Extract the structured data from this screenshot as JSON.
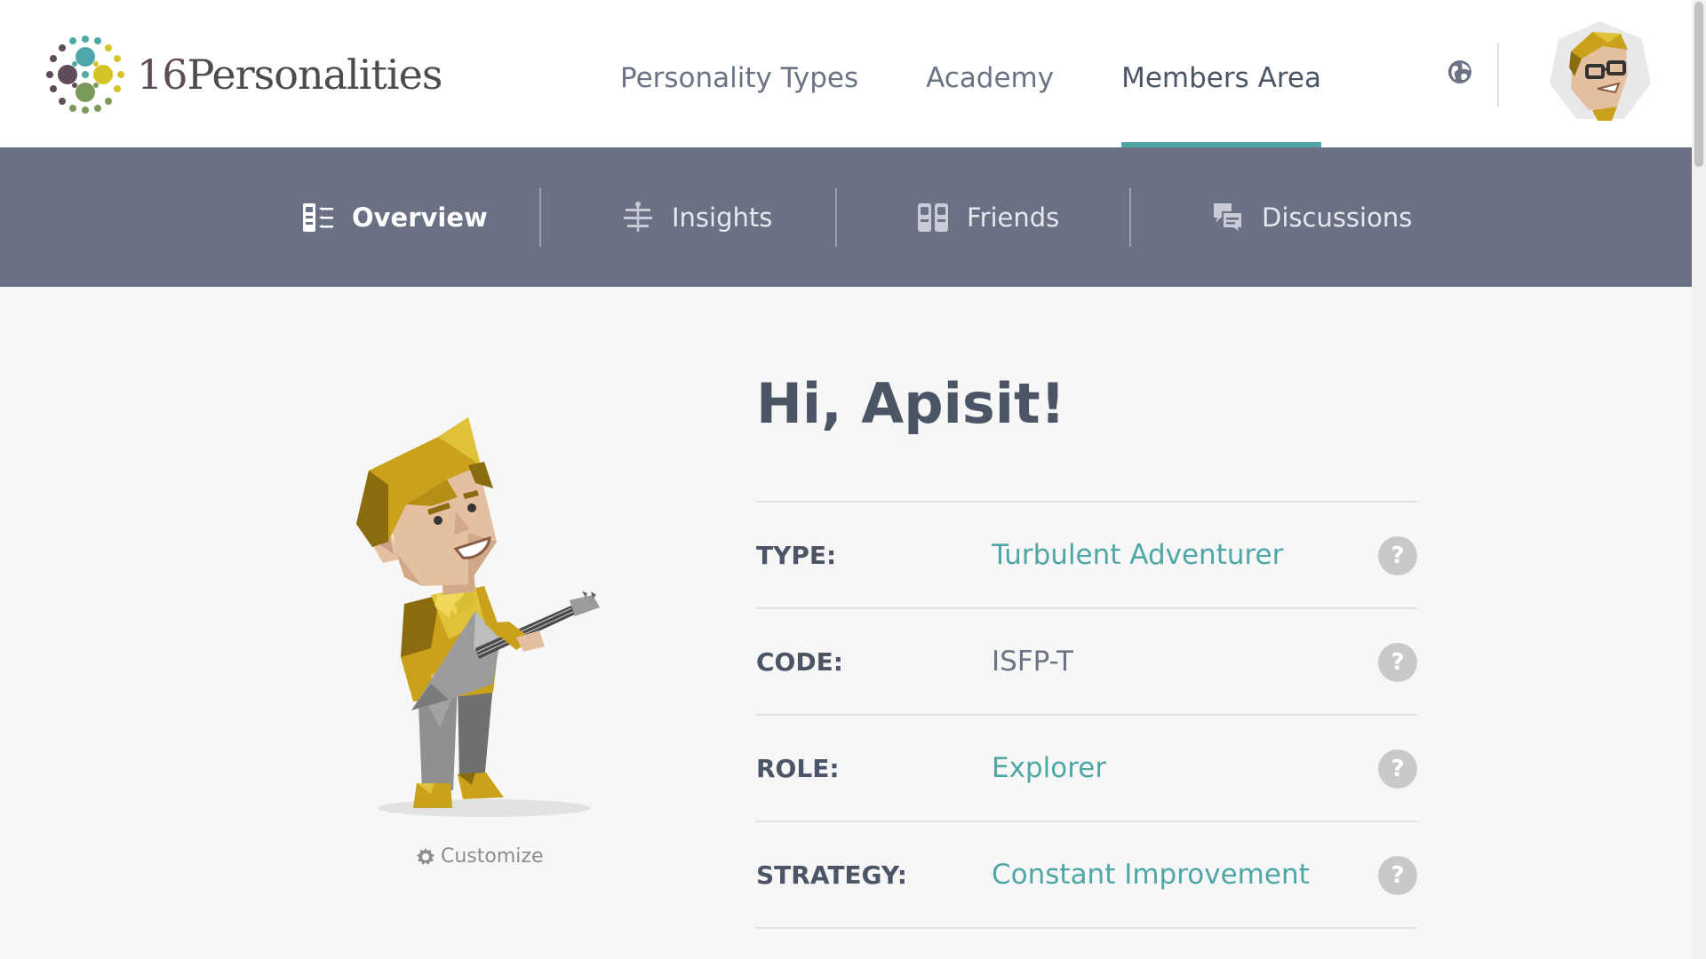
{
  "header": {
    "logo_number": "16",
    "logo_word": "Personalities",
    "nav": [
      {
        "label": "Personality Types"
      },
      {
        "label": "Academy"
      },
      {
        "label": "Members Area"
      }
    ],
    "active_nav": "Members Area",
    "globe_icon": "globe-icon",
    "avatar_icon": "user-avatar"
  },
  "subnav": {
    "items": [
      {
        "label": "Overview",
        "icon": "overview-icon"
      },
      {
        "label": "Insights",
        "icon": "insights-icon"
      },
      {
        "label": "Friends",
        "icon": "friends-icon"
      },
      {
        "label": "Discussions",
        "icon": "discussions-icon"
      }
    ],
    "active": "Overview"
  },
  "profile": {
    "greeting": "Hi, Apisit!",
    "customize_label": "Customize",
    "rows": [
      {
        "label": "TYPE:",
        "value": "Turbulent Adventurer",
        "link": true
      },
      {
        "label": "CODE:",
        "value": "ISFP-T",
        "link": false
      },
      {
        "label": "ROLE:",
        "value": "Explorer",
        "link": true
      },
      {
        "label": "STRATEGY:",
        "value": "Constant Improvement",
        "link": true
      }
    ],
    "help_symbol": "?"
  },
  "colors": {
    "accent": "#4fa6a6",
    "subnav_bg": "#6b7184",
    "text_dark": "#4c5566",
    "page_bg": "#f7f7f7"
  }
}
